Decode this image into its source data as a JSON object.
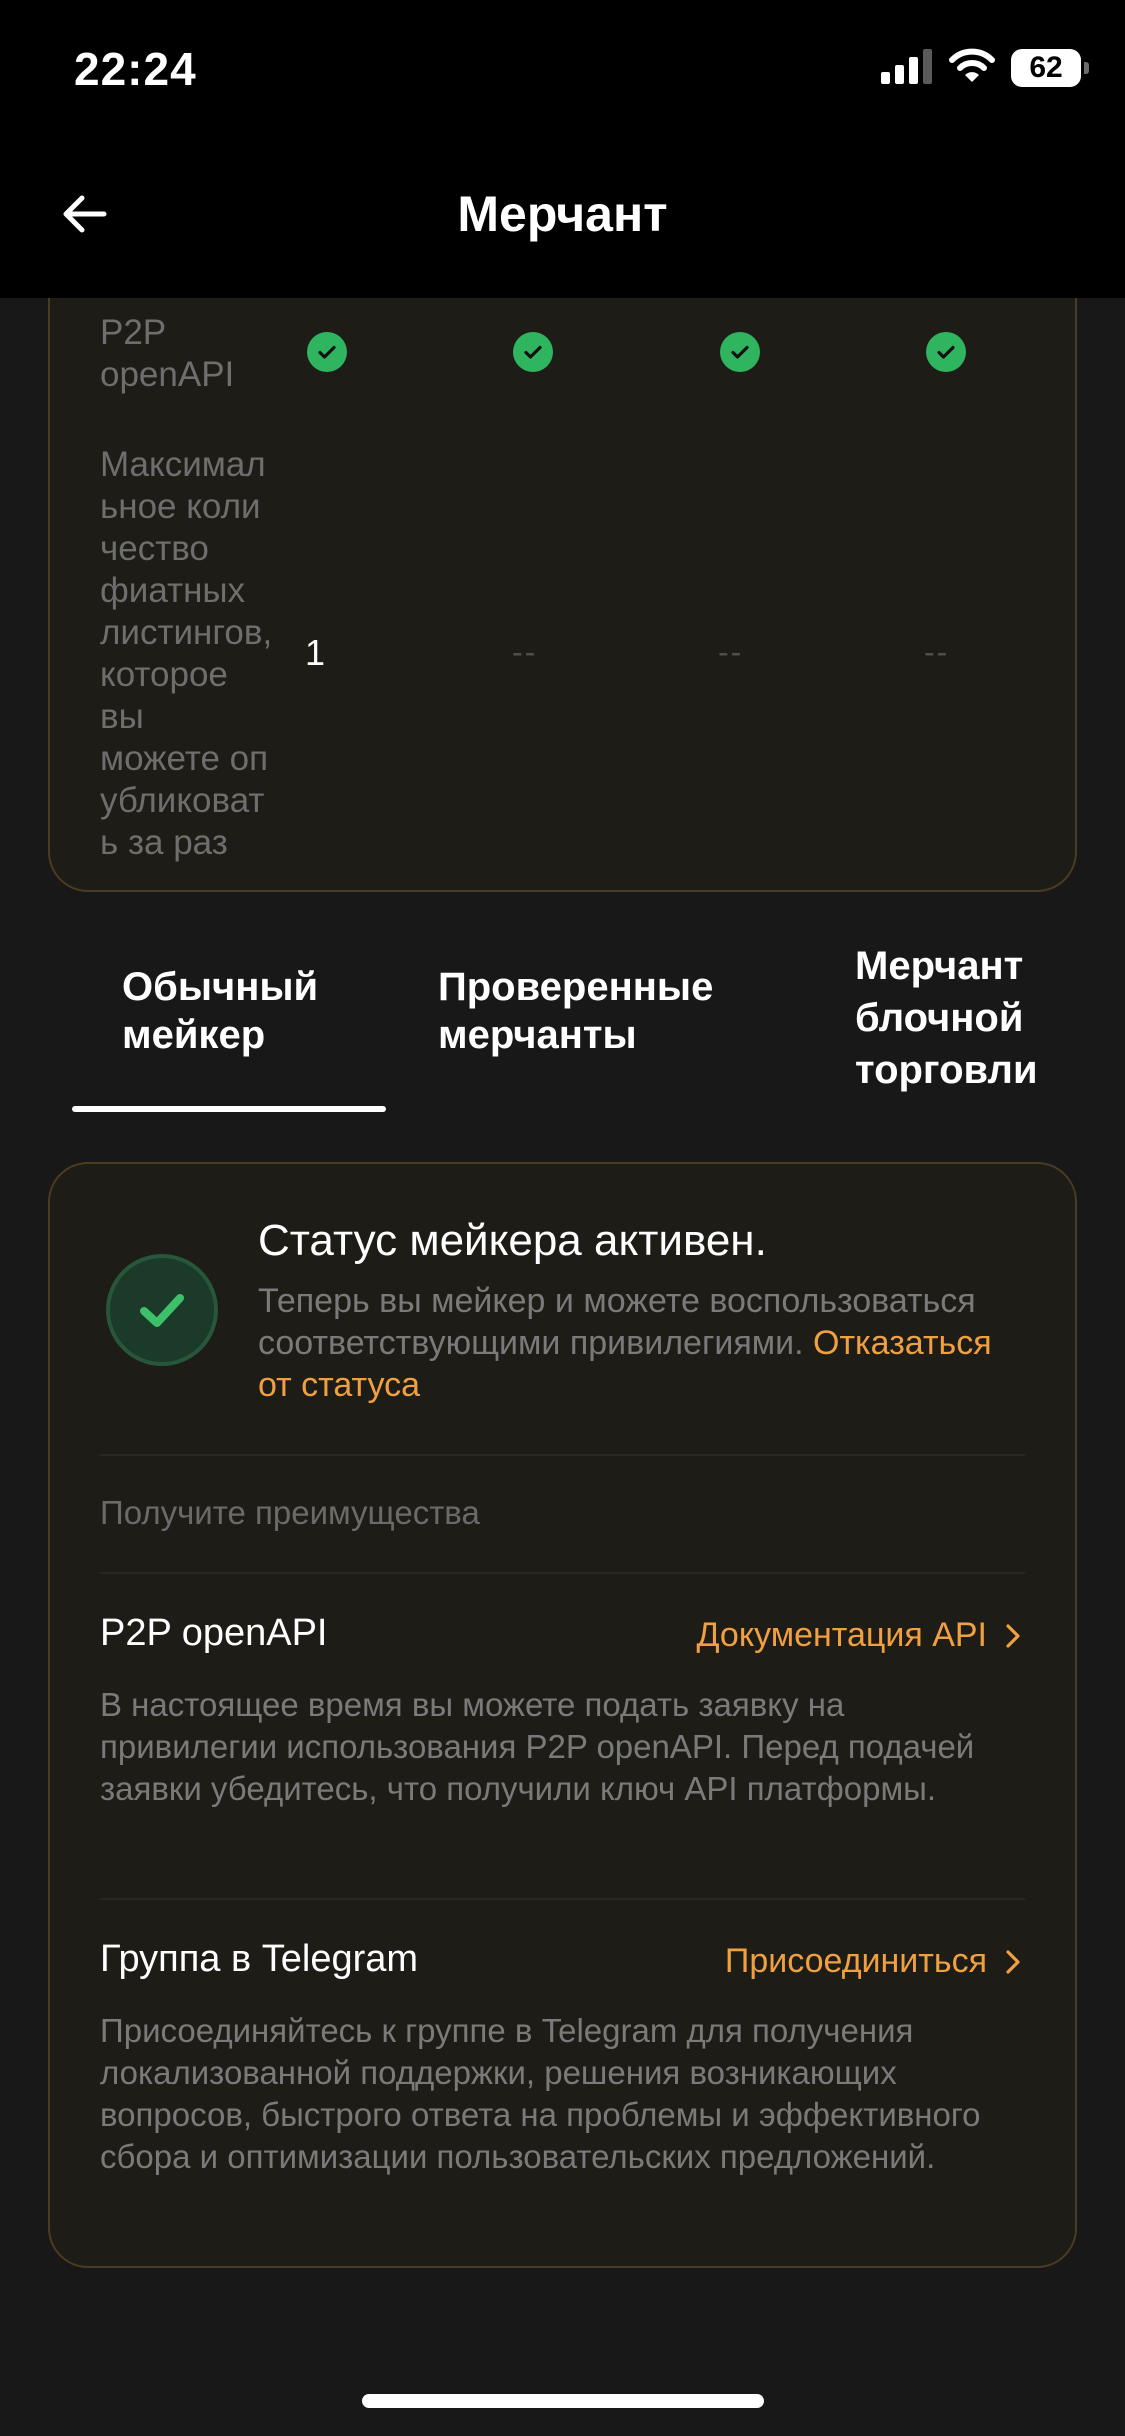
{
  "status_bar": {
    "time": "22:24",
    "battery": "62",
    "icons": [
      "signal-icon",
      "wifi-icon",
      "battery-icon"
    ]
  },
  "header": {
    "title": "Мерчант",
    "back_icon": "arrow-left-icon"
  },
  "comparison": {
    "rows": [
      {
        "label": "P2P openAPI",
        "cells": [
          "check",
          "check",
          "check",
          "check"
        ]
      },
      {
        "label": "Максимальное количество фиатных листингов, которое вы можете опубликовать за раз",
        "cells": [
          "1",
          "--",
          "--",
          "--"
        ]
      }
    ],
    "label_lines": {
      "openapi": [
        "P2P",
        "openAPI"
      ],
      "max": [
        "Максимал",
        "ьное коли",
        "чество",
        "фиатных",
        "листингов,",
        "которое",
        "вы",
        "можете оп",
        "убликоват",
        "ь за раз"
      ]
    }
  },
  "tabs": [
    {
      "label_lines": [
        "Обычный",
        "мейкер"
      ],
      "active": true
    },
    {
      "label_lines": [
        "Проверенные",
        "мерчанты"
      ],
      "active": false
    },
    {
      "label_lines": [
        "Мерчант",
        "блочной",
        "торговли"
      ],
      "active": false
    }
  ],
  "status_card": {
    "title": "Статус мейкера активен.",
    "description": "Теперь вы мейкер и можете воспользоваться соответствующими привилегиями.",
    "opt_out_link": "Отказаться от статуса",
    "benefits_heading": "Получите преимущества",
    "features": [
      {
        "title": "P2P openAPI",
        "link": "Документация API",
        "description": "В настоящее время вы можете подать заявку на привилегии использования P2P openAPI. Перед подачей заявки убедитесь, что получили ключ API платформы."
      },
      {
        "title": "Группа в Telegram",
        "link": "Присоединиться",
        "description": "Присоединяйтесь к группе в Telegram для получения локализованной поддержки, решения возникающих вопросов, быстрого ответа на проблемы и эффективного сбора и оптимизации пользовательских предложений."
      }
    ]
  },
  "colors": {
    "accent": "#f0a040",
    "success": "#2fb560",
    "card_border": "#4a3c20",
    "background": "#181818"
  }
}
